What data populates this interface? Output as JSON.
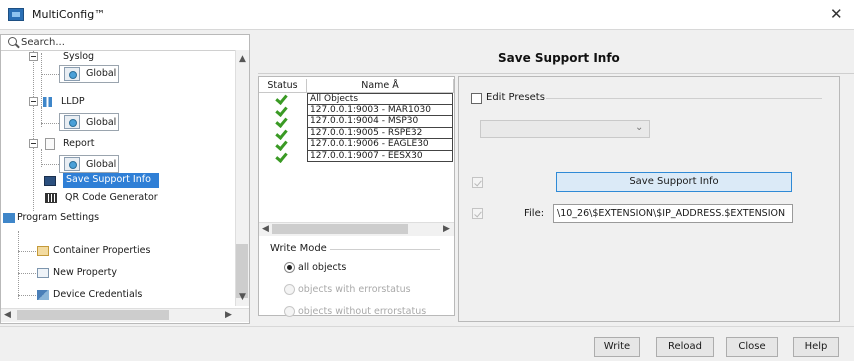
{
  "window": {
    "title": "MultiConfig™",
    "close_glyph": "✕"
  },
  "sidebar": {
    "search_placeholder": "Search...",
    "items": {
      "syslog": "Syslog",
      "syslog_global": "Global",
      "lldp": "LLDP",
      "lldp_global": "Global",
      "report": "Report",
      "report_global": "Global",
      "save_support_info": "Save Support Info",
      "qr_code_generator": "QR Code Generator",
      "program_settings": "Program Settings",
      "container_properties": "Container Properties",
      "new_property": "New Property",
      "device_credentials": "Device Credentials"
    },
    "selected": "Save Support Info"
  },
  "header": {
    "title": "Save Support Info"
  },
  "table": {
    "columns": [
      "Status",
      "Name Å"
    ],
    "rows": [
      {
        "status": "ok",
        "name": "All Objects"
      },
      {
        "status": "ok",
        "name": "127.0.0.1:9003 - MAR1030"
      },
      {
        "status": "ok",
        "name": "127.0.0.1:9004 - MSP30"
      },
      {
        "status": "ok",
        "name": "127.0.0.1:9005 - RSPE32"
      },
      {
        "status": "ok",
        "name": "127.0.0.1:9006 - EAGLE30"
      },
      {
        "status": "ok",
        "name": "127.0.0.1:9007 - EESX30"
      }
    ]
  },
  "write_mode": {
    "label": "Write Mode",
    "options": [
      "all objects",
      "objects with errorstatus",
      "objects without errorstatus"
    ],
    "selected": "all objects"
  },
  "details": {
    "edit_presets_label": "Edit Presets",
    "presets_value": "",
    "save_support_info_button": "Save Support Info",
    "file_label": "File:",
    "file_value": "\\10_26\\$EXTENSION\\$IP_ADDRESS.$EXTENSION"
  },
  "footer": {
    "write": "Write",
    "reload": "Reload",
    "close": "Close",
    "help": "Help"
  },
  "colors": {
    "selection": "#2f7fd6",
    "check_green": "#3a9a24",
    "accent_button_border": "#2f8ad6"
  }
}
